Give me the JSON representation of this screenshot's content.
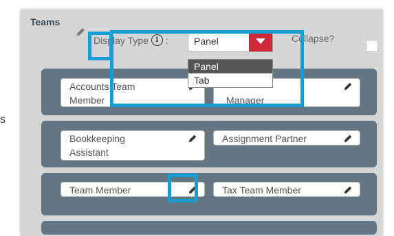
{
  "page": {
    "side_label": "s",
    "teams_label": "Teams",
    "display_type_label": "Display Type",
    "display_type_colon": ":",
    "info_glyph": "i",
    "select_value": "Panel",
    "dropdown_options": [
      "Panel",
      "Tab"
    ],
    "collapse_label": "Collapse?"
  },
  "rows": [
    {
      "chips": [
        {
          "text": "Accounts Team",
          "text2": "Member"
        },
        {
          "text": "",
          "text2": "Manager"
        }
      ]
    },
    {
      "chips": [
        {
          "text": "Bookkeeping",
          "text2": "Assistant"
        },
        {
          "text": "Assignment Partner",
          "text2": ""
        }
      ]
    },
    {
      "chips": [
        {
          "text": "Team Member",
          "text2": ""
        },
        {
          "text": "Tax Team Member",
          "text2": ""
        }
      ]
    }
  ],
  "colors": {
    "accent_blue": "#169dd4",
    "select_red": "#d0283a",
    "row_slate": "#637682"
  }
}
